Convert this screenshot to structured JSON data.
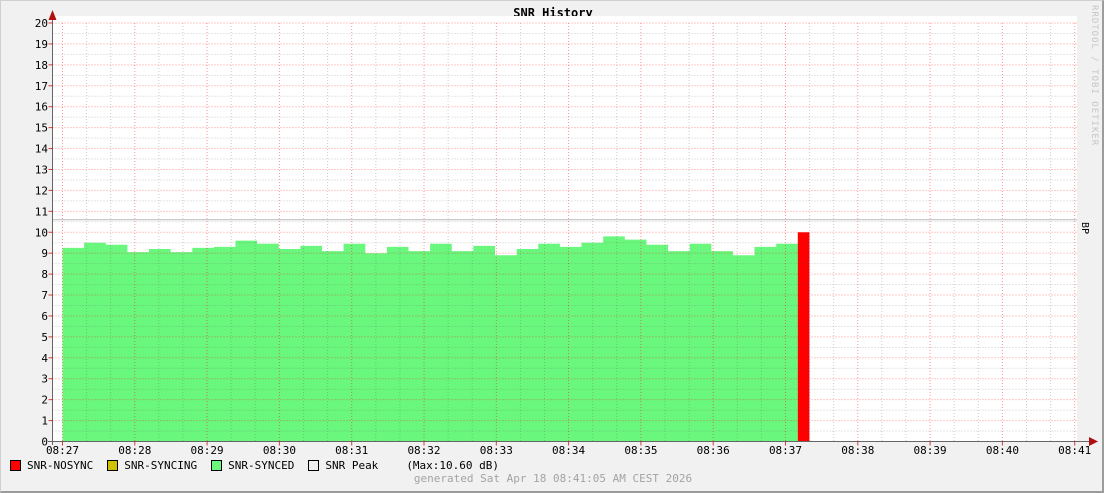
{
  "window": {
    "background": "#f1f1f1"
  },
  "chart_data": {
    "type": "area",
    "title": "SNR History",
    "x_labels": [
      "08:27",
      "08:28",
      "08:29",
      "08:30",
      "08:31",
      "08:32",
      "08:33",
      "08:34",
      "08:35",
      "08:36",
      "08:37",
      "08:38",
      "08:39",
      "08:40",
      "08:41"
    ],
    "x_minor_per_major": 3,
    "y_min": 0,
    "y_max": 20,
    "y_major": 1,
    "y_minor": 0.5,
    "ylabel": "",
    "xlabel": "",
    "right_axis_label": "BP",
    "grid": {
      "major_color": "rgba(255,0,0,0.42)",
      "minor_color": "rgba(90,90,90,0.30)"
    },
    "axis_color": "#666666",
    "arrow_color": "#b01010",
    "tick_color": "rgba(200,0,0,0.75)",
    "peak_line": {
      "label": "SNR Peak",
      "value": 10.6,
      "color": "#cbcbcb"
    },
    "series": [
      {
        "name": "SNR-SYNCED",
        "type": "area",
        "color": "#6af77e",
        "start_min": 0,
        "end_min": 10.17,
        "values": [
          9.25,
          9.5,
          9.4,
          9.05,
          9.2,
          9.05,
          9.25,
          9.3,
          9.6,
          9.45,
          9.2,
          9.35,
          9.1,
          9.45,
          9.0,
          9.3,
          9.1,
          9.45,
          9.1,
          9.35,
          8.9,
          9.2,
          9.45,
          9.3,
          9.5,
          9.8,
          9.65,
          9.4,
          9.1,
          9.45,
          9.1,
          8.9,
          9.3,
          9.45
        ]
      },
      {
        "name": "SNR-NOSYNC",
        "type": "bar",
        "color": "#ff0000",
        "start_min": 10.17,
        "end_min": 10.33,
        "value": 10.0
      }
    ]
  },
  "legend": {
    "items": [
      {
        "label": "SNR-NOSYNC",
        "color": "#ff0000"
      },
      {
        "label": "SNR-SYNCING",
        "color": "#cfc000"
      },
      {
        "label": "SNR-SYNCED",
        "color": "#6af77e"
      },
      {
        "label": "SNR Peak",
        "color": "#f0f0f0"
      }
    ],
    "max_note": "(Max:10.60 dB)"
  },
  "footer": {
    "generated": "generated Sat Apr 18 08:41:05 AM CEST 2026"
  },
  "watermark": "RRDTOOL / TOBI OETIKER"
}
